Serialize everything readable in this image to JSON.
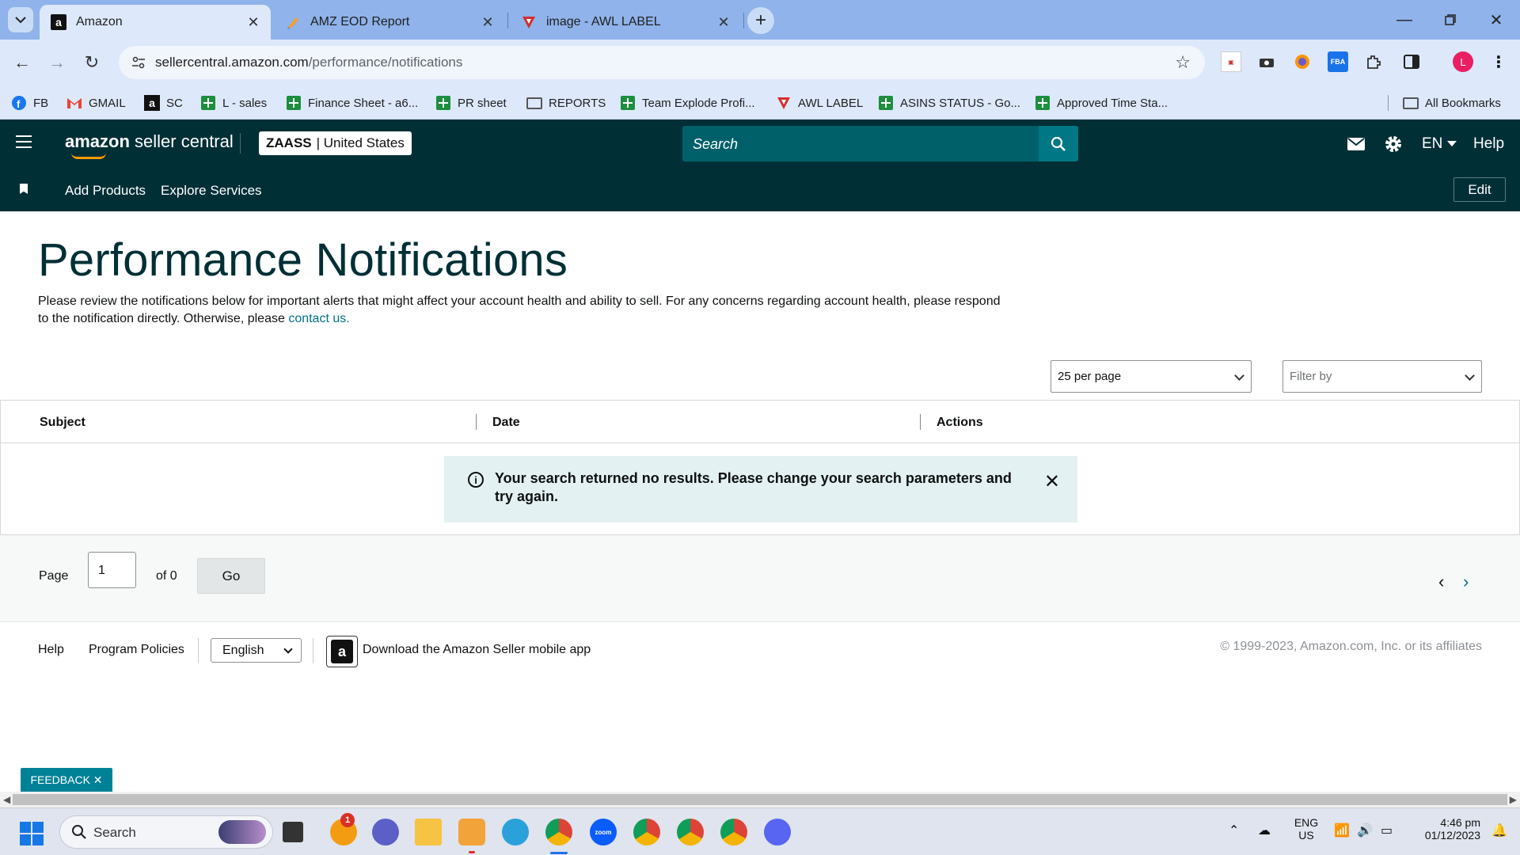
{
  "browser": {
    "tabs": [
      {
        "title": "Amazon",
        "active": true
      },
      {
        "title": "AMZ EOD Report",
        "active": false
      },
      {
        "title": "image - AWL LABEL",
        "active": false
      }
    ],
    "url_host": "sellercentral.amazon.com",
    "url_path": "/performance/notifications",
    "bookmarks": [
      {
        "label": "FB",
        "icon": "facebook-icon"
      },
      {
        "label": "GMAIL",
        "icon": "gmail-icon"
      },
      {
        "label": "SC",
        "icon": "amazon-icon"
      },
      {
        "label": "L - sales",
        "icon": "sheets-icon"
      },
      {
        "label": "Finance Sheet - a6...",
        "icon": "sheets-icon"
      },
      {
        "label": "PR sheet",
        "icon": "sheets-icon"
      },
      {
        "label": "REPORTS",
        "icon": "folder-icon"
      },
      {
        "label": "Team Explode Profi...",
        "icon": "sheets-icon"
      },
      {
        "label": "AWL LABEL",
        "icon": "awl-icon"
      },
      {
        "label": "ASINS STATUS - Go...",
        "icon": "sheets-icon"
      },
      {
        "label": "Approved Time Sta...",
        "icon": "sheets-icon"
      }
    ],
    "all_bookmarks": "All Bookmarks",
    "profile_initial": "L"
  },
  "header": {
    "logo_bold": "amazon",
    "logo_rest": " seller central",
    "store_name": "ZAASS",
    "store_region": "| United States",
    "search_placeholder": "Search",
    "language": "EN",
    "help": "Help"
  },
  "subnav": {
    "items": [
      "Add Products",
      "Explore Services"
    ],
    "edit": "Edit"
  },
  "main": {
    "title": "Performance Notifications",
    "description": "Please review the notifications below for important alerts that might affect your account health and ability to sell. For any concerns regarding account health, please respond to the notification directly. Otherwise, please ",
    "contact_link": "contact us.",
    "per_page": "25 per page",
    "filter_placeholder": "Filter by",
    "columns": [
      "Subject",
      "Date",
      "Actions"
    ],
    "alert_message": "Your search returned no results. Please change your search parameters and try again.",
    "pager": {
      "page_label": "Page",
      "page_value": "1",
      "of_label": "of 0",
      "go": "Go"
    }
  },
  "footer": {
    "help": "Help",
    "program_policies": "Program Policies",
    "language": "English",
    "app_download": "Download the Amazon Seller mobile app",
    "copyright": "© 1999-2023, Amazon.com, Inc. or its affiliates",
    "feedback": "FEEDBACK ✕"
  },
  "taskbar": {
    "search_placeholder": "Search",
    "lang_top": "ENG",
    "lang_bottom": "US",
    "time": "4:46 pm",
    "date": "01/12/2023",
    "notification_badge": "1"
  },
  "colors": {
    "header_bg": "#002f36",
    "accent": "#007185",
    "alert_bg": "#e4f1f3"
  }
}
